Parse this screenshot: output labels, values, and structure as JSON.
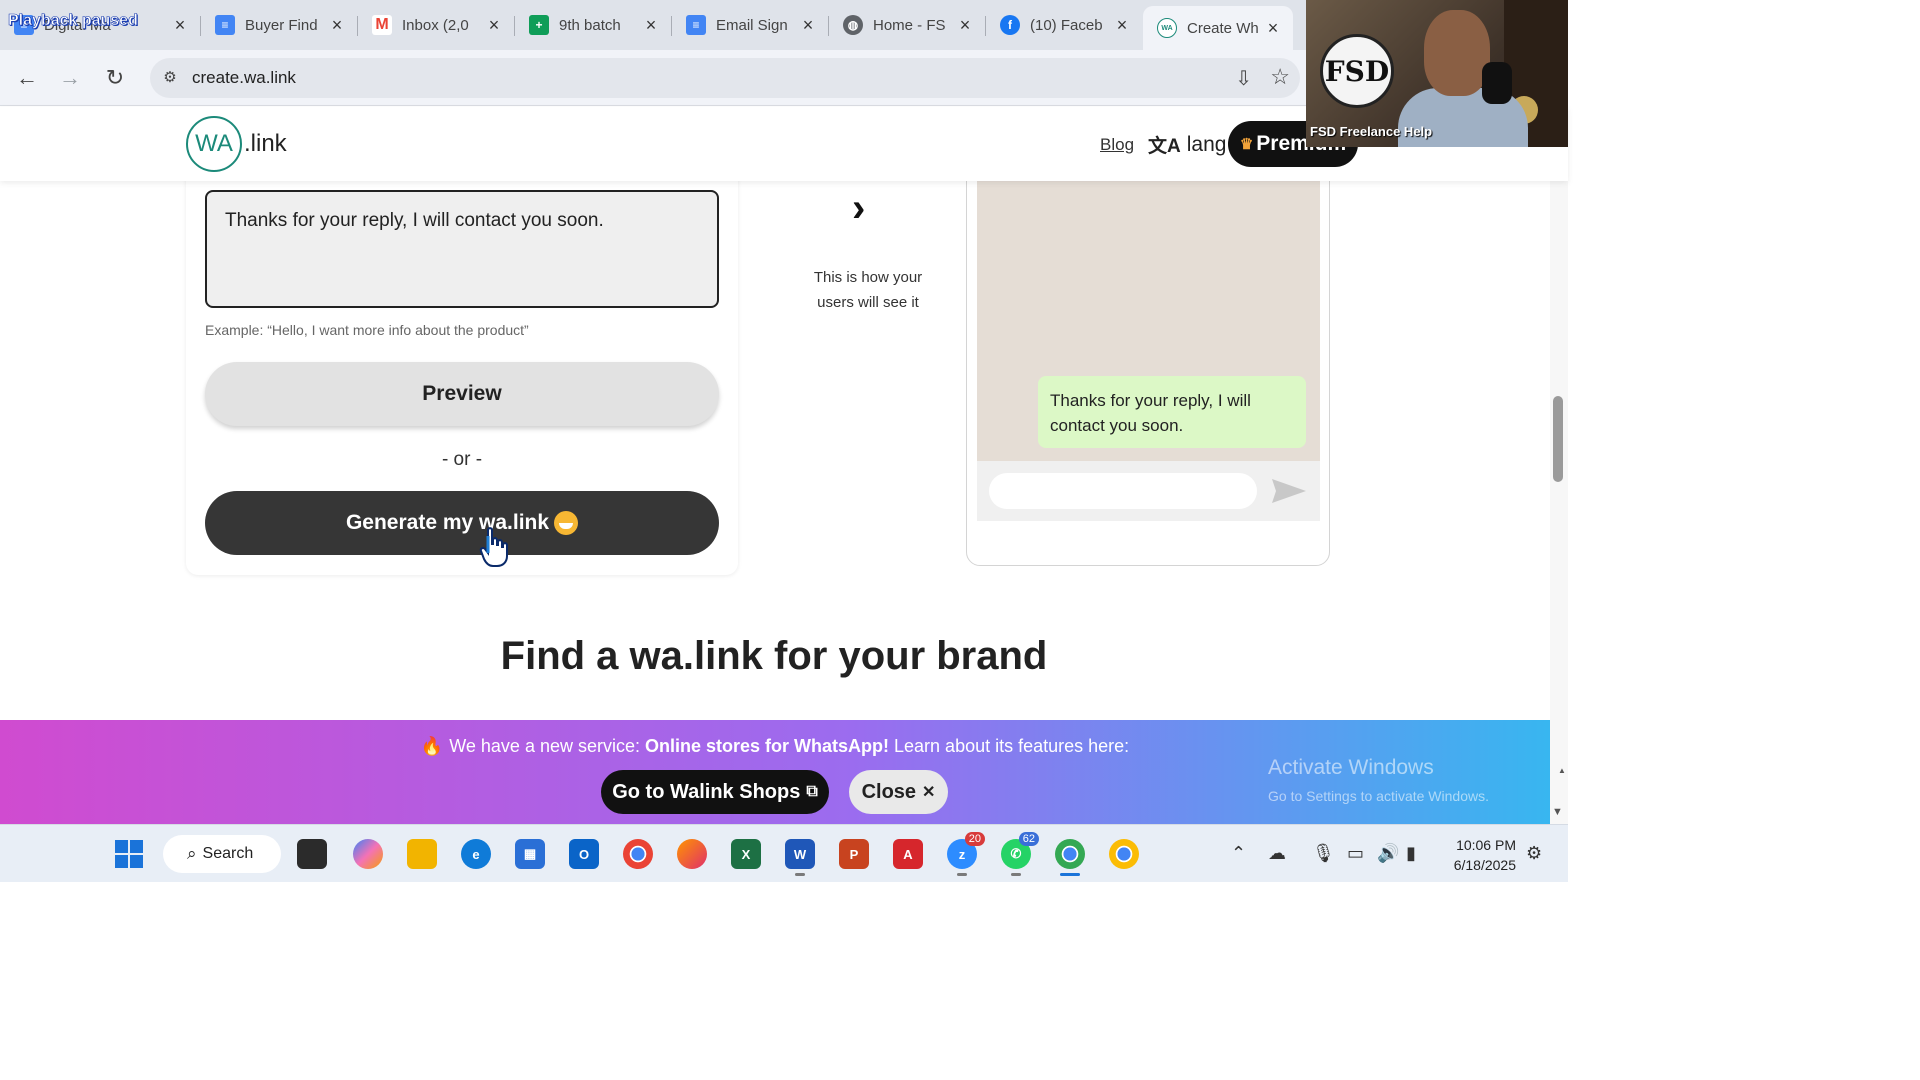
{
  "browser": {
    "playback_label": "Playback paused",
    "tabs": [
      {
        "title": "Digital Ma",
        "icon": "google-docs-icon",
        "color": "#4285f4"
      },
      {
        "title": "Buyer Find",
        "icon": "google-docs-icon",
        "color": "#4285f4"
      },
      {
        "title": "Inbox (2,0",
        "icon": "gmail-icon",
        "color": "#ea4335"
      },
      {
        "title": "9th batch",
        "icon": "google-sheets-icon",
        "color": "#0f9d58"
      },
      {
        "title": "Email Sign",
        "icon": "google-docs-icon",
        "color": "#4285f4"
      },
      {
        "title": "Home - FS",
        "icon": "globe-icon",
        "color": "#5f6368"
      },
      {
        "title": "(10) Faceb",
        "icon": "facebook-icon",
        "color": "#1877f2"
      },
      {
        "title": "Create Wh",
        "icon": "walink-icon",
        "color": "#1c8a7a"
      }
    ],
    "url": "create.wa.link"
  },
  "site": {
    "logo_mark": "WA",
    "logo_text": ".link",
    "nav": {
      "blog": "Blog",
      "lang_icon": "文A",
      "lang": "lang",
      "premium": "Premium"
    }
  },
  "form": {
    "message_value": "Thanks for your reply, I will contact you soon.",
    "example": "Example: “Hello, I want more info about the product”",
    "preview_label": "Preview",
    "or_label": "- or -",
    "generate_label": "Generate my wa.link"
  },
  "preview": {
    "arrow": "›",
    "caption": "This is how your users will see it",
    "bubble_text": "Thanks for your reply, I will contact you soon."
  },
  "section": {
    "heading": "Find a wa.link for your brand"
  },
  "promo": {
    "text_before": "We have a new service: ",
    "text_bold": "Online stores for WhatsApp!",
    "text_after": " Learn about its features here:",
    "shops_button": "Go to Walink Shops",
    "close_button": "Close"
  },
  "watermark": {
    "line1": "Activate Windows",
    "line2": "Go to Settings to activate Windows."
  },
  "webcam": {
    "logo": "FSD",
    "caption": "FSD Freelance Help"
  },
  "taskbar": {
    "search_label": "Search",
    "zoom_badge": "20",
    "whatsapp_badge": "62",
    "time": "10:06 PM",
    "date": "6/18/2025"
  },
  "colors": {
    "brand": "#1c8a7a",
    "bubble": "#dcf8c6",
    "chat_bg": "#e5ddd5",
    "promo_start": "#d04bd0",
    "promo_end": "#38b6f0"
  }
}
